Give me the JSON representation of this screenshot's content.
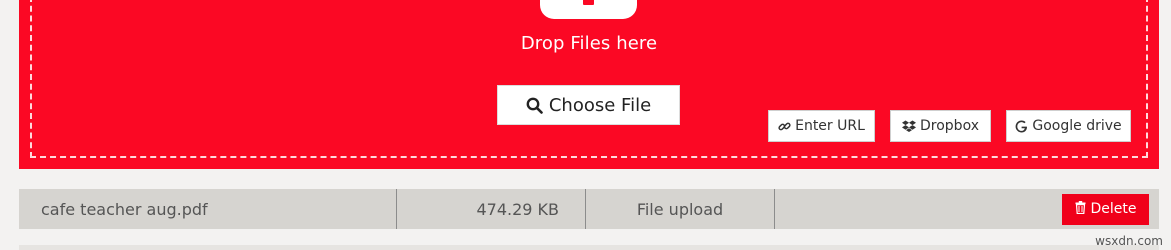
{
  "dropzone": {
    "drop_text": "Drop Files here",
    "choose_label": "Choose File",
    "sources": {
      "url_label": "Enter URL",
      "dropbox_label": "Dropbox",
      "gdrive_label": "Google drive"
    },
    "colors": {
      "accent": "#fb0824",
      "border": "#ffffff"
    }
  },
  "files": {
    "rows": [
      {
        "name": "cafe teacher aug.pdf",
        "size": "474.29 KB",
        "status": "File upload",
        "delete_label": "Delete"
      }
    ]
  },
  "watermark": "wsxdn.com",
  "icons": {
    "upload": "upload-icon",
    "search": "search-icon",
    "link": "link-icon",
    "dropbox": "dropbox-icon",
    "google": "google-icon",
    "trash": "trash-icon"
  }
}
